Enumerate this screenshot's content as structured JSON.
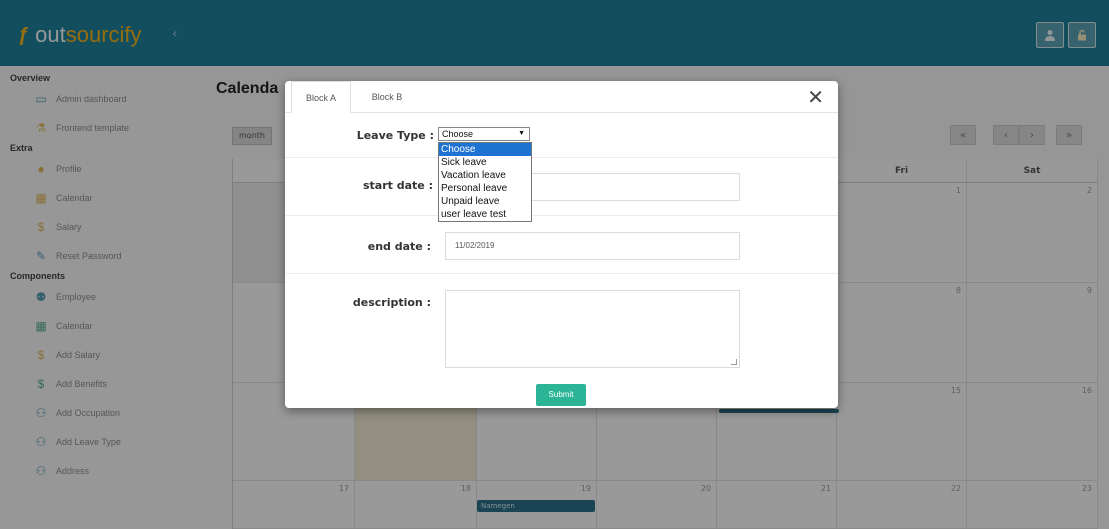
{
  "header": {
    "logo_mark": "ƒ",
    "logo_out": "out",
    "logo_rest": "sourcify",
    "collapse_icon": "‹",
    "user_icon": "user-icon",
    "lock_icon": "unlock-icon"
  },
  "sidebar": {
    "sections": [
      {
        "title": "Overview",
        "items": [
          {
            "label": "Admin dashboard",
            "icon": "monitor-icon"
          },
          {
            "label": "Frontend template",
            "icon": "flask-icon"
          }
        ]
      },
      {
        "title": "Extra",
        "items": [
          {
            "label": "Profile",
            "icon": "user-icon"
          },
          {
            "label": "Calendar",
            "icon": "calendar-icon"
          },
          {
            "label": "Salary",
            "icon": "dollar-icon"
          },
          {
            "label": "Reset Password",
            "icon": "wrench-icon"
          }
        ]
      },
      {
        "title": "Components",
        "items": [
          {
            "label": "Employee",
            "icon": "add-user-icon"
          },
          {
            "label": "Calendar",
            "icon": "calendar-icon"
          },
          {
            "label": "Add Salary",
            "icon": "dollar-icon"
          },
          {
            "label": "Add Benefits",
            "icon": "dollar-icon"
          },
          {
            "label": "Add Occupation",
            "icon": "users-icon"
          },
          {
            "label": "Add Leave Type",
            "icon": "users-icon"
          },
          {
            "label": "Address",
            "icon": "users-icon"
          }
        ]
      }
    ]
  },
  "main": {
    "title": "Calenda",
    "view_button": "month",
    "nav": [
      "«",
      "‹",
      "›",
      "»"
    ]
  },
  "calendar": {
    "headers": [
      "",
      "",
      "",
      "",
      "",
      "Fri",
      "Sat"
    ],
    "row2": [
      "",
      "",
      "",
      "",
      "",
      "1",
      "2"
    ],
    "row3": [
      "",
      "",
      "",
      "",
      "",
      "8",
      "9"
    ],
    "row4": [
      "",
      "",
      "",
      "",
      "",
      "15",
      "16"
    ],
    "row5": [
      "17",
      "18",
      "19",
      "20",
      "21",
      "22",
      "23"
    ],
    "event_label": "Namegen"
  },
  "modal": {
    "tabs": [
      "Block A",
      "Block B"
    ],
    "close": "✕",
    "leave_type_label": "Leave Type :",
    "start_date_label": "start date :",
    "end_date_label": "end date :",
    "description_label": "description :",
    "select_value": "Choose",
    "options": [
      "Choose",
      "Sick leave",
      "Vacation leave",
      "Personal leave",
      "Unpaid leave",
      "user leave test"
    ],
    "selected_option": "Choose",
    "start_date_value": "",
    "end_date_value": "11/02/2019",
    "description_value": "",
    "submit_label": "Submit"
  }
}
